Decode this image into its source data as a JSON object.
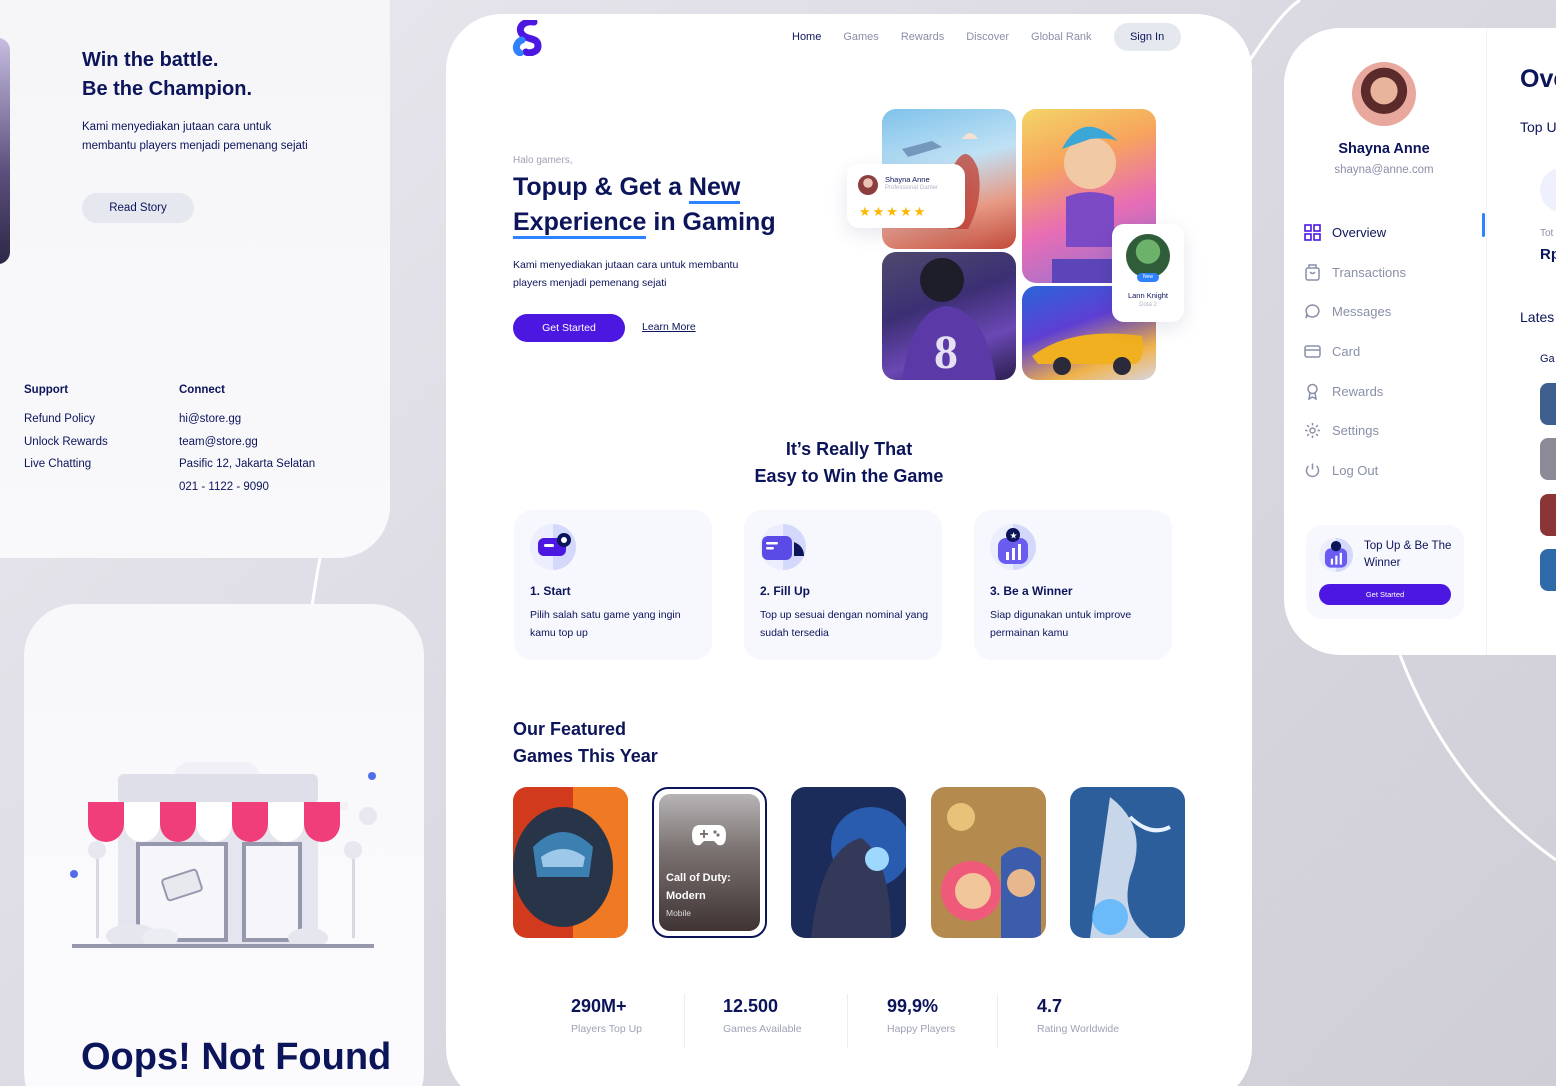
{
  "story": {
    "heading_line1": "Win the battle.",
    "heading_line2": "Be the Champion.",
    "description": "Kami menyediakan jutaan cara untuk membantu players menjadi pemenang sejati",
    "read_button": "Read Story"
  },
  "footer": {
    "support_title": "Support",
    "support_items": [
      "Refund Policy",
      "Unlock Rewards",
      "Live Chatting"
    ],
    "connect_title": "Connect",
    "connect_items": [
      "hi@store.gg",
      "team@store.gg",
      "Pasific 12, Jakarta Selatan",
      "021 - 1122 - 9090"
    ]
  },
  "not_found": {
    "title": "Oops! Not Found"
  },
  "nav": {
    "items": [
      "Home",
      "Games",
      "Rewards",
      "Discover",
      "Global Rank"
    ],
    "sign_in": "Sign In"
  },
  "hero": {
    "greeting": "Halo gamers,",
    "title_part1": "Topup & Get a ",
    "title_highlight1": "New",
    "title_highlight2": "Experience",
    "title_part2": " in Gaming",
    "description": "Kami menyediakan jutaan cara untuk membantu players menjadi pemenang sejati",
    "cta": "Get Started",
    "learn_more": "Learn More",
    "review": {
      "name": "Shayna Anne",
      "role": "Professional Gamer",
      "stars": "★★★★★"
    },
    "player": {
      "badge": "New",
      "name": "Lann Knight",
      "game": "Dota 2"
    }
  },
  "steps": {
    "title_line1": "It’s Really That",
    "title_line2": "Easy to Win the Game",
    "items": [
      {
        "title": "1. Start",
        "desc": "Pilih salah satu game yang ingin kamu top up"
      },
      {
        "title": "2. Fill Up",
        "desc": "Top up sesuai dengan nominal yang sudah tersedia"
      },
      {
        "title": "3. Be a Winner",
        "desc": "Siap digunakan untuk improve permainan kamu"
      }
    ]
  },
  "featured": {
    "title_line1": "Our Featured",
    "title_line2": "Games This Year",
    "active_game": {
      "title": "Call of Duty: Modern",
      "platform": "Mobile"
    }
  },
  "stats": [
    {
      "value": "290M+",
      "label": "Players Top Up"
    },
    {
      "value": "12.500",
      "label": "Games Available"
    },
    {
      "value": "99,9%",
      "label": "Happy Players"
    },
    {
      "value": "4.7",
      "label": "Rating Worldwide"
    }
  ],
  "dashboard": {
    "user_name": "Shayna Anne",
    "user_email": "shayna@anne.com",
    "menu": [
      "Overview",
      "Transactions",
      "Messages",
      "Card",
      "Rewards",
      "Settings",
      "Log Out"
    ],
    "promo_text": "Top Up & Be The Winner",
    "promo_button": "Get Started",
    "overview_title": "Ove",
    "overview_sub": "Top U",
    "tot_label": "Tot",
    "rp_label": "Rp",
    "latest_label": "Lates",
    "ga_label": "Ga"
  },
  "colors": {
    "navy": "#0c145a",
    "primary": "#4d17e2",
    "accent_blue": "#2e82ff",
    "muted": "#8a8fa8",
    "star": "#ffb600"
  }
}
